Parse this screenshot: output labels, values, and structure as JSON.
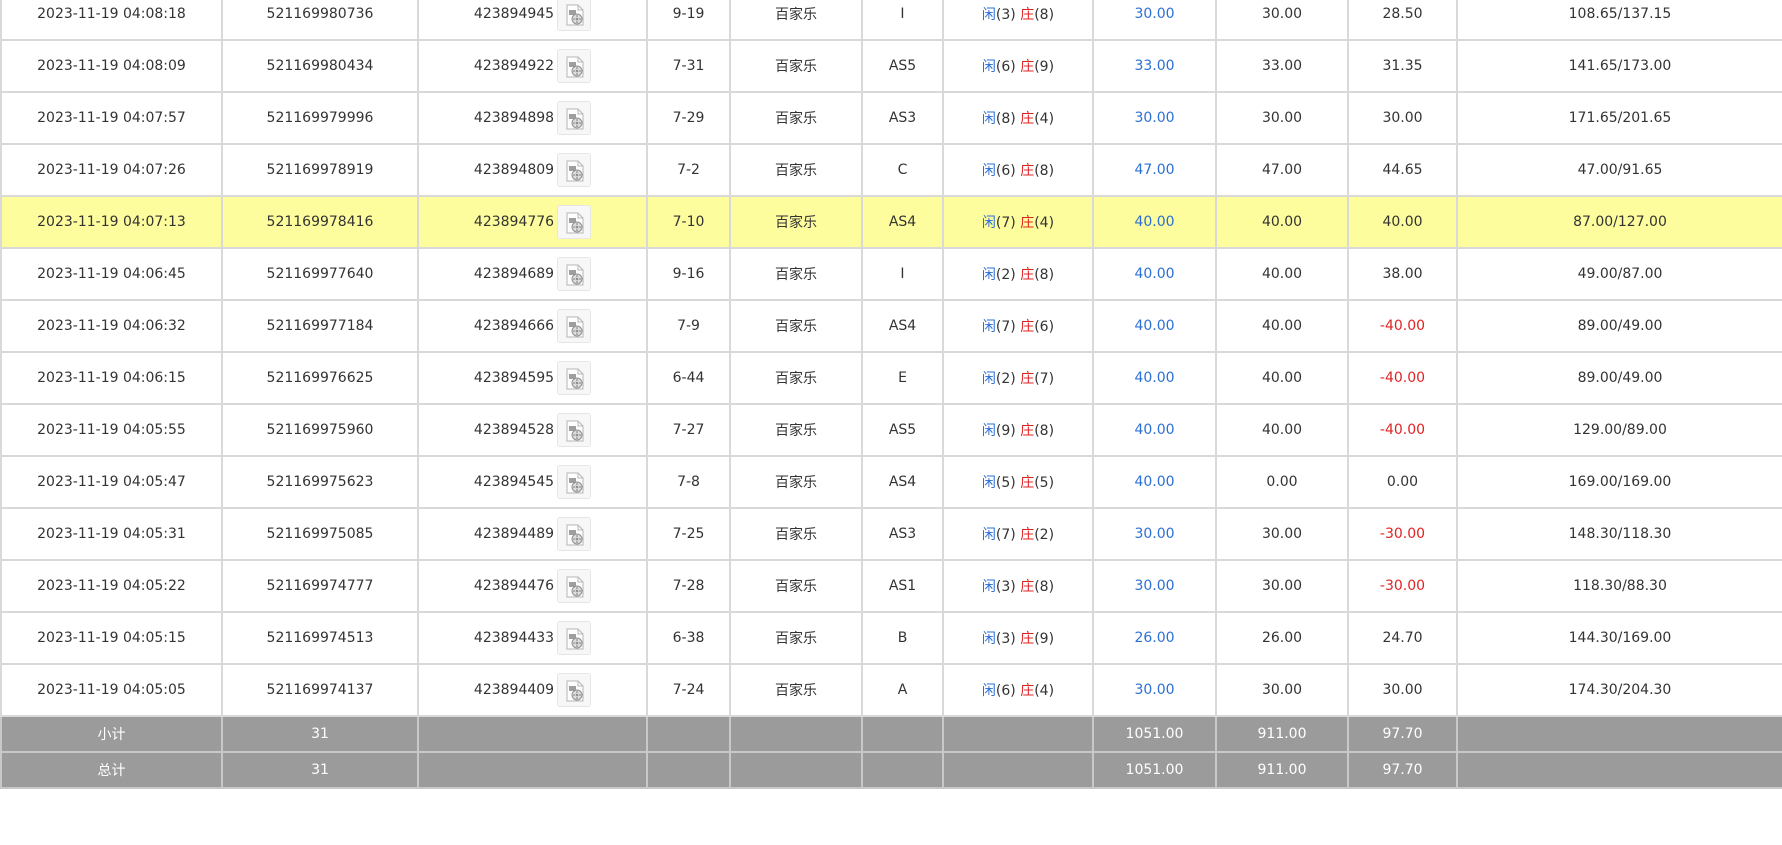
{
  "colors": {
    "player": "#2b6fd6",
    "banker": "#e02424",
    "negative": "#e02424",
    "highlight_row": "#fdfd9d",
    "total_row": "#9b9b9b"
  },
  "icons": {
    "replay": "replay-video-icon"
  },
  "rows": [
    {
      "time": "2023-11-19 04:08:18",
      "bet_no": "521169980736",
      "round": "423894945",
      "shoe": "9-19",
      "game": "百家乐",
      "table": "I",
      "player_label": "闲",
      "player_pts": "(3)",
      "banker_label": "庄",
      "banker_pts": "(8)",
      "bet": "30.00",
      "valid": "30.00",
      "win": "28.50",
      "balance": "108.65/137.15",
      "highlight": false,
      "negative": false
    },
    {
      "time": "2023-11-19 04:08:09",
      "bet_no": "521169980434",
      "round": "423894922",
      "shoe": "7-31",
      "game": "百家乐",
      "table": "AS5",
      "player_label": "闲",
      "player_pts": "(6)",
      "banker_label": "庄",
      "banker_pts": "(9)",
      "bet": "33.00",
      "valid": "33.00",
      "win": "31.35",
      "balance": "141.65/173.00",
      "highlight": false,
      "negative": false
    },
    {
      "time": "2023-11-19 04:07:57",
      "bet_no": "521169979996",
      "round": "423894898",
      "shoe": "7-29",
      "game": "百家乐",
      "table": "AS3",
      "player_label": "闲",
      "player_pts": "(8)",
      "banker_label": "庄",
      "banker_pts": "(4)",
      "bet": "30.00",
      "valid": "30.00",
      "win": "30.00",
      "balance": "171.65/201.65",
      "highlight": false,
      "negative": false
    },
    {
      "time": "2023-11-19 04:07:26",
      "bet_no": "521169978919",
      "round": "423894809",
      "shoe": "7-2",
      "game": "百家乐",
      "table": "C",
      "player_label": "闲",
      "player_pts": "(6)",
      "banker_label": "庄",
      "banker_pts": "(8)",
      "bet": "47.00",
      "valid": "47.00",
      "win": "44.65",
      "balance": "47.00/91.65",
      "highlight": false,
      "negative": false
    },
    {
      "time": "2023-11-19 04:07:13",
      "bet_no": "521169978416",
      "round": "423894776",
      "shoe": "7-10",
      "game": "百家乐",
      "table": "AS4",
      "player_label": "闲",
      "player_pts": "(7)",
      "banker_label": "庄",
      "banker_pts": "(4)",
      "bet": "40.00",
      "valid": "40.00",
      "win": "40.00",
      "balance": "87.00/127.00",
      "highlight": true,
      "negative": false
    },
    {
      "time": "2023-11-19 04:06:45",
      "bet_no": "521169977640",
      "round": "423894689",
      "shoe": "9-16",
      "game": "百家乐",
      "table": "I",
      "player_label": "闲",
      "player_pts": "(2)",
      "banker_label": "庄",
      "banker_pts": "(8)",
      "bet": "40.00",
      "valid": "40.00",
      "win": "38.00",
      "balance": "49.00/87.00",
      "highlight": false,
      "negative": false
    },
    {
      "time": "2023-11-19 04:06:32",
      "bet_no": "521169977184",
      "round": "423894666",
      "shoe": "7-9",
      "game": "百家乐",
      "table": "AS4",
      "player_label": "闲",
      "player_pts": "(7)",
      "banker_label": "庄",
      "banker_pts": "(6)",
      "bet": "40.00",
      "valid": "40.00",
      "win": "-40.00",
      "balance": "89.00/49.00",
      "highlight": false,
      "negative": true
    },
    {
      "time": "2023-11-19 04:06:15",
      "bet_no": "521169976625",
      "round": "423894595",
      "shoe": "6-44",
      "game": "百家乐",
      "table": "E",
      "player_label": "闲",
      "player_pts": "(2)",
      "banker_label": "庄",
      "banker_pts": "(7)",
      "bet": "40.00",
      "valid": "40.00",
      "win": "-40.00",
      "balance": "89.00/49.00",
      "highlight": false,
      "negative": true
    },
    {
      "time": "2023-11-19 04:05:55",
      "bet_no": "521169975960",
      "round": "423894528",
      "shoe": "7-27",
      "game": "百家乐",
      "table": "AS5",
      "player_label": "闲",
      "player_pts": "(9)",
      "banker_label": "庄",
      "banker_pts": "(8)",
      "bet": "40.00",
      "valid": "40.00",
      "win": "-40.00",
      "balance": "129.00/89.00",
      "highlight": false,
      "negative": true
    },
    {
      "time": "2023-11-19 04:05:47",
      "bet_no": "521169975623",
      "round": "423894545",
      "shoe": "7-8",
      "game": "百家乐",
      "table": "AS4",
      "player_label": "闲",
      "player_pts": "(5)",
      "banker_label": "庄",
      "banker_pts": "(5)",
      "bet": "40.00",
      "valid": "0.00",
      "win": "0.00",
      "balance": "169.00/169.00",
      "highlight": false,
      "negative": false
    },
    {
      "time": "2023-11-19 04:05:31",
      "bet_no": "521169975085",
      "round": "423894489",
      "shoe": "7-25",
      "game": "百家乐",
      "table": "AS3",
      "player_label": "闲",
      "player_pts": "(7)",
      "banker_label": "庄",
      "banker_pts": "(2)",
      "bet": "30.00",
      "valid": "30.00",
      "win": "-30.00",
      "balance": "148.30/118.30",
      "highlight": false,
      "negative": true
    },
    {
      "time": "2023-11-19 04:05:22",
      "bet_no": "521169974777",
      "round": "423894476",
      "shoe": "7-28",
      "game": "百家乐",
      "table": "AS1",
      "player_label": "闲",
      "player_pts": "(3)",
      "banker_label": "庄",
      "banker_pts": "(8)",
      "bet": "30.00",
      "valid": "30.00",
      "win": "-30.00",
      "balance": "118.30/88.30",
      "highlight": false,
      "negative": true
    },
    {
      "time": "2023-11-19 04:05:15",
      "bet_no": "521169974513",
      "round": "423894433",
      "shoe": "6-38",
      "game": "百家乐",
      "table": "B",
      "player_label": "闲",
      "player_pts": "(3)",
      "banker_label": "庄",
      "banker_pts": "(9)",
      "bet": "26.00",
      "valid": "26.00",
      "win": "24.70",
      "balance": "144.30/169.00",
      "highlight": false,
      "negative": false
    },
    {
      "time": "2023-11-19 04:05:05",
      "bet_no": "521169974137",
      "round": "423894409",
      "shoe": "7-24",
      "game": "百家乐",
      "table": "A",
      "player_label": "闲",
      "player_pts": "(6)",
      "banker_label": "庄",
      "banker_pts": "(4)",
      "bet": "30.00",
      "valid": "30.00",
      "win": "30.00",
      "balance": "174.30/204.30",
      "highlight": false,
      "negative": false
    }
  ],
  "totals": [
    {
      "label": "小计",
      "count": "31",
      "bet": "1051.00",
      "valid": "911.00",
      "win": "97.70"
    },
    {
      "label": "总计",
      "count": "31",
      "bet": "1051.00",
      "valid": "911.00",
      "win": "97.70"
    }
  ]
}
